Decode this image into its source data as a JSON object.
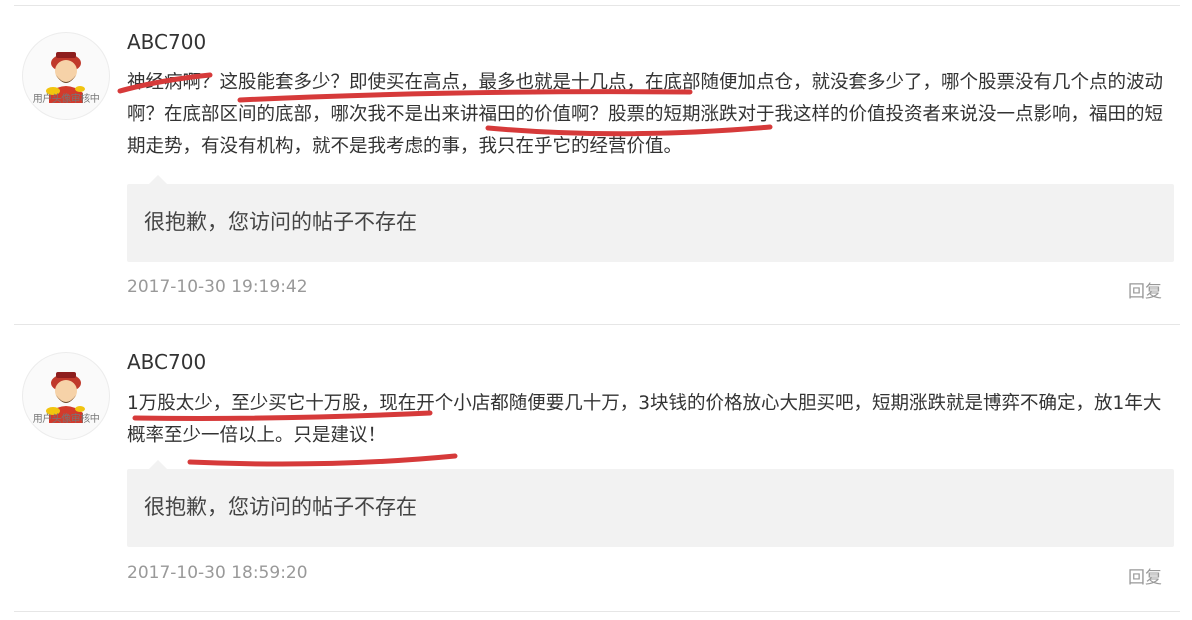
{
  "comments": [
    {
      "avatar_caption": "用户头像审核中",
      "username": "ABC700",
      "text": "神经病啊？这股能套多少？即使买在高点，最多也就是十几点，在底部随便加点仓，就没套多少了，哪个股票没有几个点的波动啊？在底部区间的底部，哪次我不是出来讲福田的价值啊？股票的短期涨跌对于我这样的价值投资者来说没一点影响，福田的短期走势，有没有机构，就不是我考虑的事，我只在乎它的经营价值。",
      "quoted_post": "很抱歉，您访问的帖子不存在",
      "timestamp": "2017-10-30 19:19:42",
      "reply_label": "回复"
    },
    {
      "avatar_caption": "用户头像审核中",
      "username": "ABC700",
      "text": "1万股太少，至少买它十万股，现在开个小店都随便要几十万，3块钱的价格放心大胆买吧，短期涨跌就是博弈不确定，放1年大概率至少一倍以上。只是建议！",
      "quoted_post": "很抱歉，您访问的帖子不存在",
      "timestamp": "2017-10-30 18:59:20",
      "reply_label": "回复"
    }
  ],
  "colors": {
    "annotation_marker": "#d63a3a",
    "quote_background": "#f2f2f2",
    "meta_text": "#999999"
  }
}
